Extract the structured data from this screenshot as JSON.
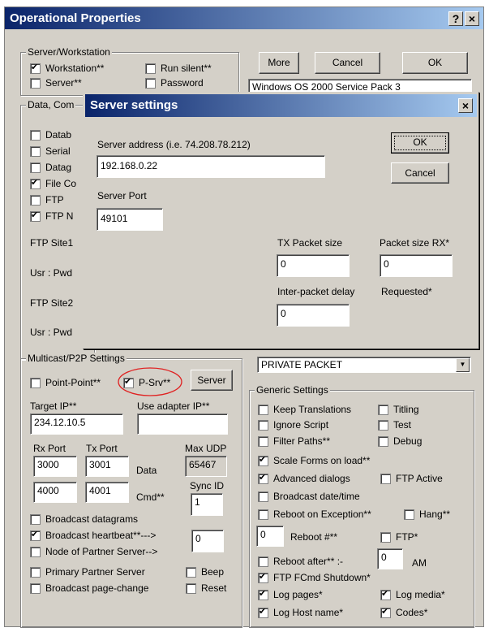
{
  "main_window": {
    "title": "Operational Properties",
    "help_label": "?",
    "close_label": "×",
    "more_label": "More",
    "cancel_label": "Cancel",
    "ok_label": "OK",
    "os_text": "Windows OS 2000 Service Pack 3",
    "server_group": {
      "label": "Server/Workstation",
      "workstation": "Workstation**",
      "run_silent": "Run silent**",
      "server": "Server**",
      "password": "Password"
    },
    "data_group": {
      "label_visible": "Data, Com",
      "items": [
        "Datab",
        "Serial",
        "Datag",
        "File Co",
        "FTP",
        "FTP N"
      ],
      "checked": [
        false,
        false,
        false,
        true,
        false,
        true
      ],
      "ftp_site1": "FTP Site1",
      "usr_pwd1": "Usr : Pwd",
      "ftp_site2": "FTP Site2",
      "usr_pwd2": "Usr : Pwd"
    },
    "multicast_group": {
      "label_visible": "Multicast/P2P Settings",
      "point_point": "Point-Point**",
      "p_srv": "P-Srv**",
      "server_btn": "Server",
      "target_ip_label": "Target IP**",
      "use_adapter_label": "Use adapter IP**",
      "target_ip_value": "234.12.10.5",
      "use_adapter_value": "",
      "rx_port_label": "Rx Port",
      "tx_port_label": "Tx Port",
      "max_udp_label": "Max UDP",
      "rx_port_value": "3000",
      "tx_port_value": "3001",
      "data_label": "Data",
      "max_udp_value": "65467",
      "cmd_rx_value": "4000",
      "cmd_tx_value": "4001",
      "cmd_label": "Cmd**",
      "sync_id_label": "Sync ID",
      "sync_id_value": "1",
      "broadcast_datagrams": "Broadcast datagrams",
      "broadcast_heartbeat": "Broadcast heartbeat**--->",
      "heartbeat_value": "0",
      "node_partner": "Node of Partner Server-->",
      "primary_partner": "Primary Partner Server",
      "beep": "Beep",
      "broadcast_page_change": "Broadcast page-change",
      "reset": "Reset"
    },
    "private_packet_value": "PRIVATE PACKET",
    "generic_group": {
      "label": "Generic Settings",
      "keep_translations": "Keep Translations",
      "titling": "Titling",
      "ignore_script": "Ignore Script",
      "test": "Test",
      "filter_paths": "Filter Paths**",
      "debug": "Debug",
      "scale_forms": "Scale Forms on load**",
      "advanced_dialogs": "Advanced dialogs",
      "ftp_active": "FTP Active",
      "broadcast_datetime": "Broadcast date/time",
      "reboot_exception": "Reboot on Exception**",
      "hang": "Hang**",
      "reboot_num_value": "0",
      "reboot_num_label": "Reboot #**",
      "ftp_star": "FTP*",
      "reboot_after": "Reboot after** :-",
      "reboot_after_value": "0",
      "am": "AM",
      "ftp_fcmd": "FTP FCmd Shutdown*",
      "log_pages": "Log pages*",
      "log_media": "Log media*",
      "log_host": "Log Host name*",
      "codes": "Codes*"
    }
  },
  "server_dialog": {
    "title": "Server settings",
    "close_label": "×",
    "address_label": "Server address (i.e. 74.208.78.212)",
    "address_value": "192.168.0.22",
    "port_label": "Server Port",
    "port_value": "49101",
    "ok_label": "OK",
    "cancel_label": "Cancel",
    "tx_packet_label": "TX Packet size",
    "rx_packet_label": "Packet size RX*",
    "tx_packet_value": "0",
    "rx_packet_value": "0",
    "inter_packet_label": "Inter-packet delay",
    "requested_label": "Requested*",
    "inter_packet_value": "0"
  },
  "colors": {
    "title_gradient_start": "#0a246a",
    "title_gradient_end": "#a6caf0",
    "dialog_face": "#d4d0c8",
    "annotation_circle": "#e02020"
  }
}
